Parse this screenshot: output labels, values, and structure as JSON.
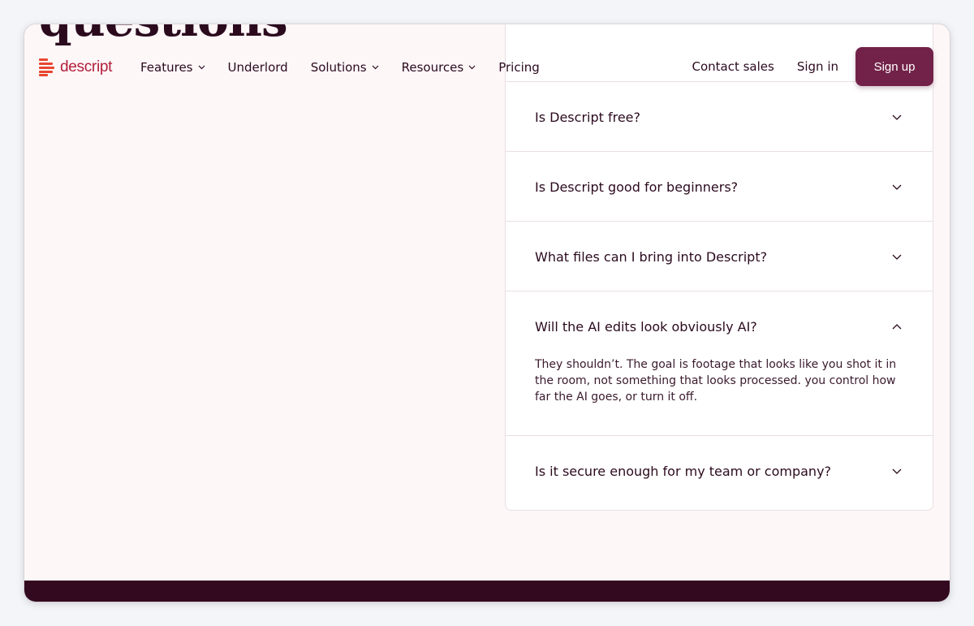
{
  "heading": "questions",
  "brand": {
    "name": "descript",
    "color": "#b21f3a"
  },
  "nav": {
    "items": [
      {
        "label": "Features",
        "has_menu": true
      },
      {
        "label": "Underlord",
        "has_menu": false
      },
      {
        "label": "Solutions",
        "has_menu": true
      },
      {
        "label": "Resources",
        "has_menu": true
      },
      {
        "label": "Pricing",
        "has_menu": false
      }
    ],
    "contact_sales": "Contact sales",
    "sign_in": "Sign in",
    "sign_up": "Sign up",
    "accent": "#722249"
  },
  "faq": [
    {
      "question": "Is Descript free?",
      "expanded": false
    },
    {
      "question": "Is Descript good for beginners?",
      "expanded": false
    },
    {
      "question": "What files can I bring into Descript?",
      "expanded": false
    },
    {
      "question": "Will the AI edits look obviously AI?",
      "expanded": true,
      "answer": "They shouldn’t. The goal is footage that looks like you shot it in the room, not something that looks processed. you control how far the AI goes, or turn it off."
    },
    {
      "question": "Is it secure enough for my team or company?",
      "expanded": false
    }
  ],
  "footer_color": "#33091f"
}
